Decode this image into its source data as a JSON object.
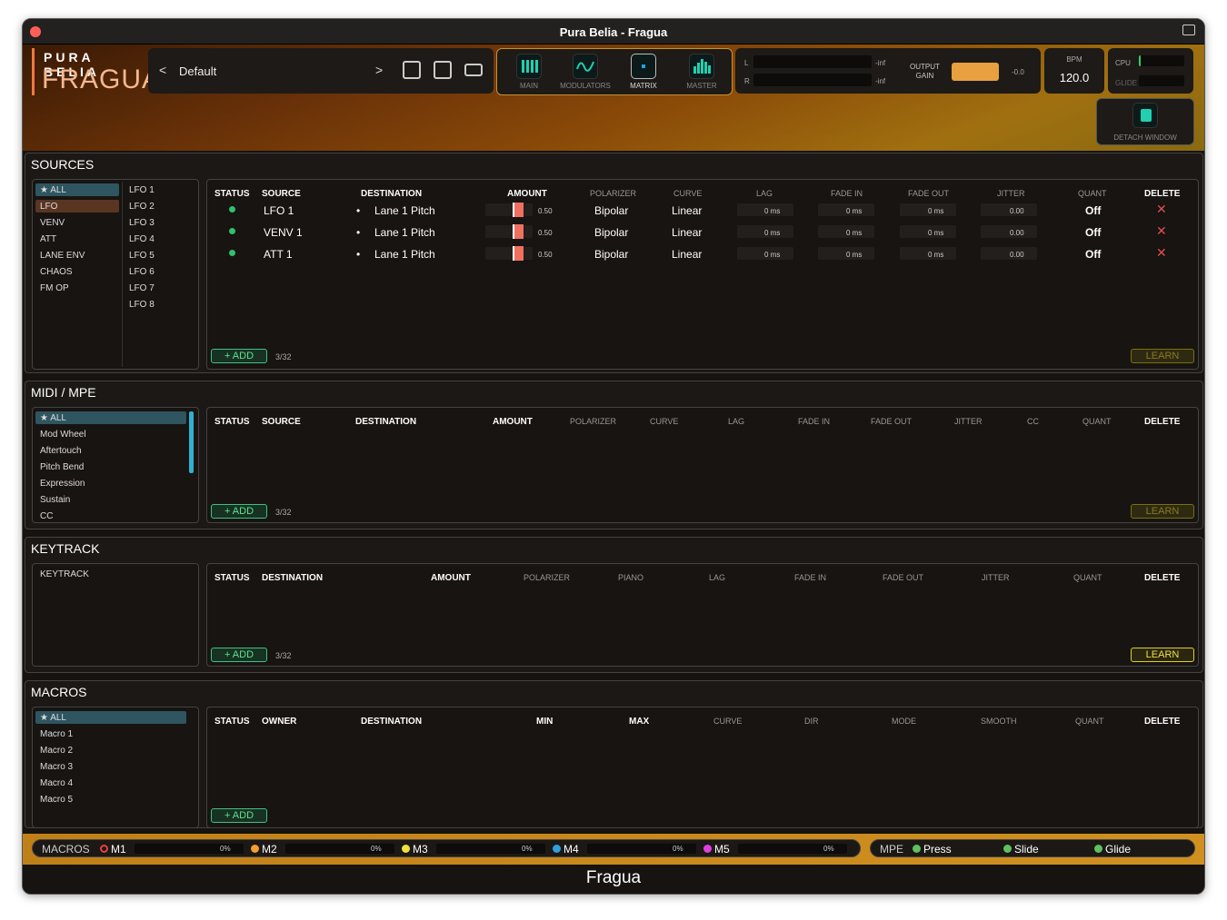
{
  "window": {
    "title": "Pura Belia - Fragua"
  },
  "logo": {
    "brand": "PURA BELIA",
    "product": "FRAGUA"
  },
  "preset": {
    "prev": "<",
    "name": "Default",
    "next": ">"
  },
  "tabs": [
    {
      "label": "MAIN"
    },
    {
      "label": "MODULATORS"
    },
    {
      "label": "MATRIX"
    },
    {
      "label": "MASTER"
    }
  ],
  "meter": {
    "l": "L",
    "r": "R",
    "l_val": "-inf",
    "r_val": "-inf",
    "output_gain_label": "OUTPUT\nGAIN",
    "gain_db": "-0.0"
  },
  "bpm": {
    "label": "BPM",
    "value": "120.0"
  },
  "cpu": {
    "cpu_label": "CPU",
    "glide_label": "GLIDE"
  },
  "detach": {
    "label": "DETACH WINDOW"
  },
  "sources": {
    "title": "SOURCES",
    "categories": [
      "★ ALL",
      "LFO",
      "VENV",
      "ATT",
      "LANE ENV",
      "CHAOS",
      "FM OP"
    ],
    "items": [
      "LFO 1",
      "LFO 2",
      "LFO 3",
      "LFO 4",
      "LFO 5",
      "LFO 6",
      "LFO 7",
      "LFO 8"
    ],
    "headers": {
      "status": "STATUS",
      "source": "SOURCE",
      "destination": "DESTINATION",
      "amount": "AMOUNT",
      "polarizer": "POLARIZER",
      "curve": "CURVE",
      "lag": "LAG",
      "fade_in": "FADE IN",
      "fade_out": "FADE OUT",
      "jitter": "JITTER",
      "quant": "QUANT",
      "delete": "DELETE"
    },
    "rows": [
      {
        "source": "LFO 1",
        "destination": "Lane 1 Pitch",
        "amount": "0.50",
        "polarizer": "Bipolar",
        "curve": "Linear",
        "lag": "0 ms",
        "fade_in": "0 ms",
        "fade_out": "0 ms",
        "jitter": "0.00",
        "quant": "Off"
      },
      {
        "source": "VENV 1",
        "destination": "Lane 1 Pitch",
        "amount": "0.50",
        "polarizer": "Bipolar",
        "curve": "Linear",
        "lag": "0 ms",
        "fade_in": "0 ms",
        "fade_out": "0 ms",
        "jitter": "0.00",
        "quant": "Off"
      },
      {
        "source": "ATT 1",
        "destination": "Lane 1 Pitch",
        "amount": "0.50",
        "polarizer": "Bipolar",
        "curve": "Linear",
        "lag": "0 ms",
        "fade_in": "0 ms",
        "fade_out": "0 ms",
        "jitter": "0.00",
        "quant": "Off"
      }
    ],
    "add": "+ ADD",
    "count": "3/32",
    "learn": "LEARN"
  },
  "midi": {
    "title": "MIDI / MPE",
    "items": [
      "★ ALL",
      "Mod Wheel",
      "Aftertouch",
      "Pitch Bend",
      "Expression",
      "Sustain",
      "CC"
    ],
    "headers": {
      "status": "STATUS",
      "source": "SOURCE",
      "destination": "DESTINATION",
      "amount": "AMOUNT",
      "polarizer": "POLARIZER",
      "curve": "CURVE",
      "lag": "LAG",
      "fade_in": "FADE IN",
      "fade_out": "FADE OUT",
      "jitter": "JITTER",
      "cc": "CC",
      "quant": "QUANT",
      "delete": "DELETE"
    },
    "add": "+ ADD",
    "count": "3/32",
    "learn": "LEARN"
  },
  "keytrack": {
    "title": "KEYTRACK",
    "items": [
      "KEYTRACK"
    ],
    "headers": {
      "status": "STATUS",
      "destination": "DESTINATION",
      "amount": "AMOUNT",
      "polarizer": "POLARIZER",
      "piano": "PIANO",
      "lag": "LAG",
      "fade_in": "FADE IN",
      "fade_out": "FADE OUT",
      "jitter": "JITTER",
      "quant": "QUANT",
      "delete": "DELETE"
    },
    "add": "+ ADD",
    "count": "3/32",
    "learn": "LEARN"
  },
  "macros": {
    "title": "MACROS",
    "items": [
      "★ ALL",
      "Macro 1",
      "Macro 2",
      "Macro 3",
      "Macro 4",
      "Macro 5"
    ],
    "headers": {
      "status": "STATUS",
      "owner": "OWNER",
      "destination": "DESTINATION",
      "min": "MIN",
      "max": "MAX",
      "curve": "CURVE",
      "dir": "DIR",
      "mode": "MODE",
      "smooth": "SMOOTH",
      "quant": "QUANT",
      "delete": "DELETE"
    },
    "add": "+ ADD"
  },
  "bottom_bar": {
    "macros_label": "MACROS",
    "macros": [
      {
        "name": "M1",
        "value": "0%",
        "color": "#e84040"
      },
      {
        "name": "M2",
        "value": "0%",
        "color": "#f0a030"
      },
      {
        "name": "M3",
        "value": "0%",
        "color": "#f0e040"
      },
      {
        "name": "M4",
        "value": "0%",
        "color": "#30a0e0"
      },
      {
        "name": "M5",
        "value": "0%",
        "color": "#e040e0"
      }
    ],
    "mpe_label": "MPE",
    "mpe": [
      {
        "name": "Press",
        "color": "#60c060"
      },
      {
        "name": "Slide",
        "color": "#60c060"
      },
      {
        "name": "Glide",
        "color": "#60c060"
      }
    ]
  },
  "footer": {
    "title": "Fragua"
  },
  "colors": {
    "accent": "#f07840",
    "add_green": "#40c080",
    "learn_yellow": "#e0d020",
    "delete_red": "#e05050"
  }
}
